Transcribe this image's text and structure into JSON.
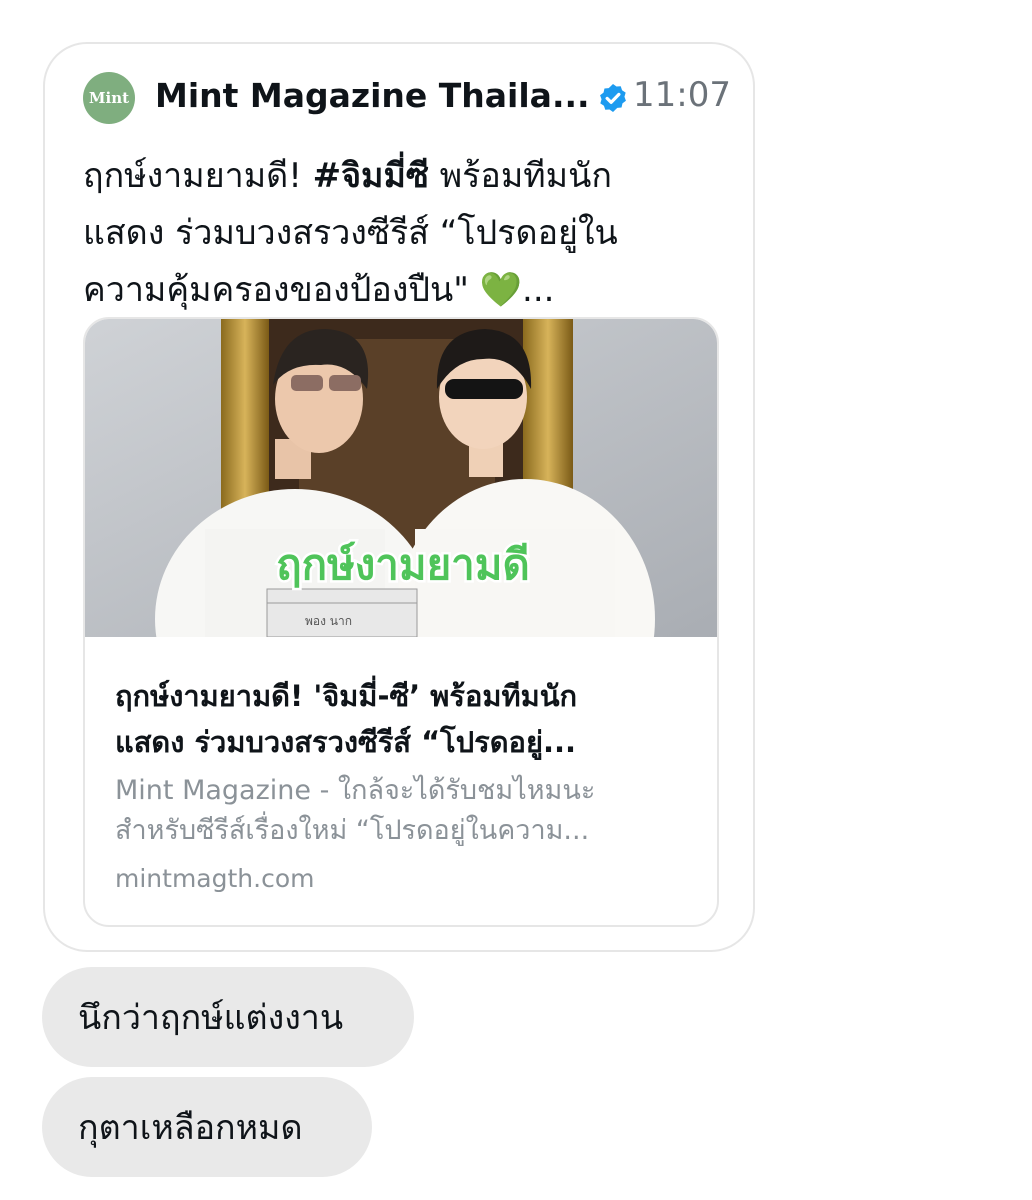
{
  "tweet": {
    "avatar_text": "Mint",
    "display_name": "Mint Magazine Thaila...",
    "verified_icon": "verified-badge-icon",
    "time": "11:07",
    "text_line1_a": "ฤกษ์งามยามดี! ",
    "text_line1_tag": "#จิมมี่ซี",
    "text_line1_b": " พร้อมทีมนัก",
    "text_line2": "แสดง ร่วมบวงสรวงซีรีส์ “โปรดอยู่ใน",
    "text_line3": "ความคุ้มครองของป้องปืน\" ",
    "text_line3_emoji": "💚",
    "text_line3_ellipsis": "...",
    "accent_color": "#1d9bf0"
  },
  "link_card": {
    "image_overlay_text": "ฤกษ์งามยามดี",
    "image_slate_text": "พอง นาก",
    "title_line1": "ฤกษ์งามยามดี! 'จิมมี่-ซี’ พร้อมทีมนัก",
    "title_line2": "แสดง ร่วมบวงสรวงซีรีส์ “โปรดอยู่...",
    "desc_line1": "Mint Magazine - ใกล้จะได้รับชมไหมนะ",
    "desc_line2": "สำหรับซีรีส์เรื่องใหม่ “โปรดอยู่ในความ...",
    "domain": "mintmagth.com"
  },
  "replies": [
    {
      "text": "นึกว่าฤกษ์แต่งงาน"
    },
    {
      "text": "กุตาเหลือกหมด"
    }
  ]
}
